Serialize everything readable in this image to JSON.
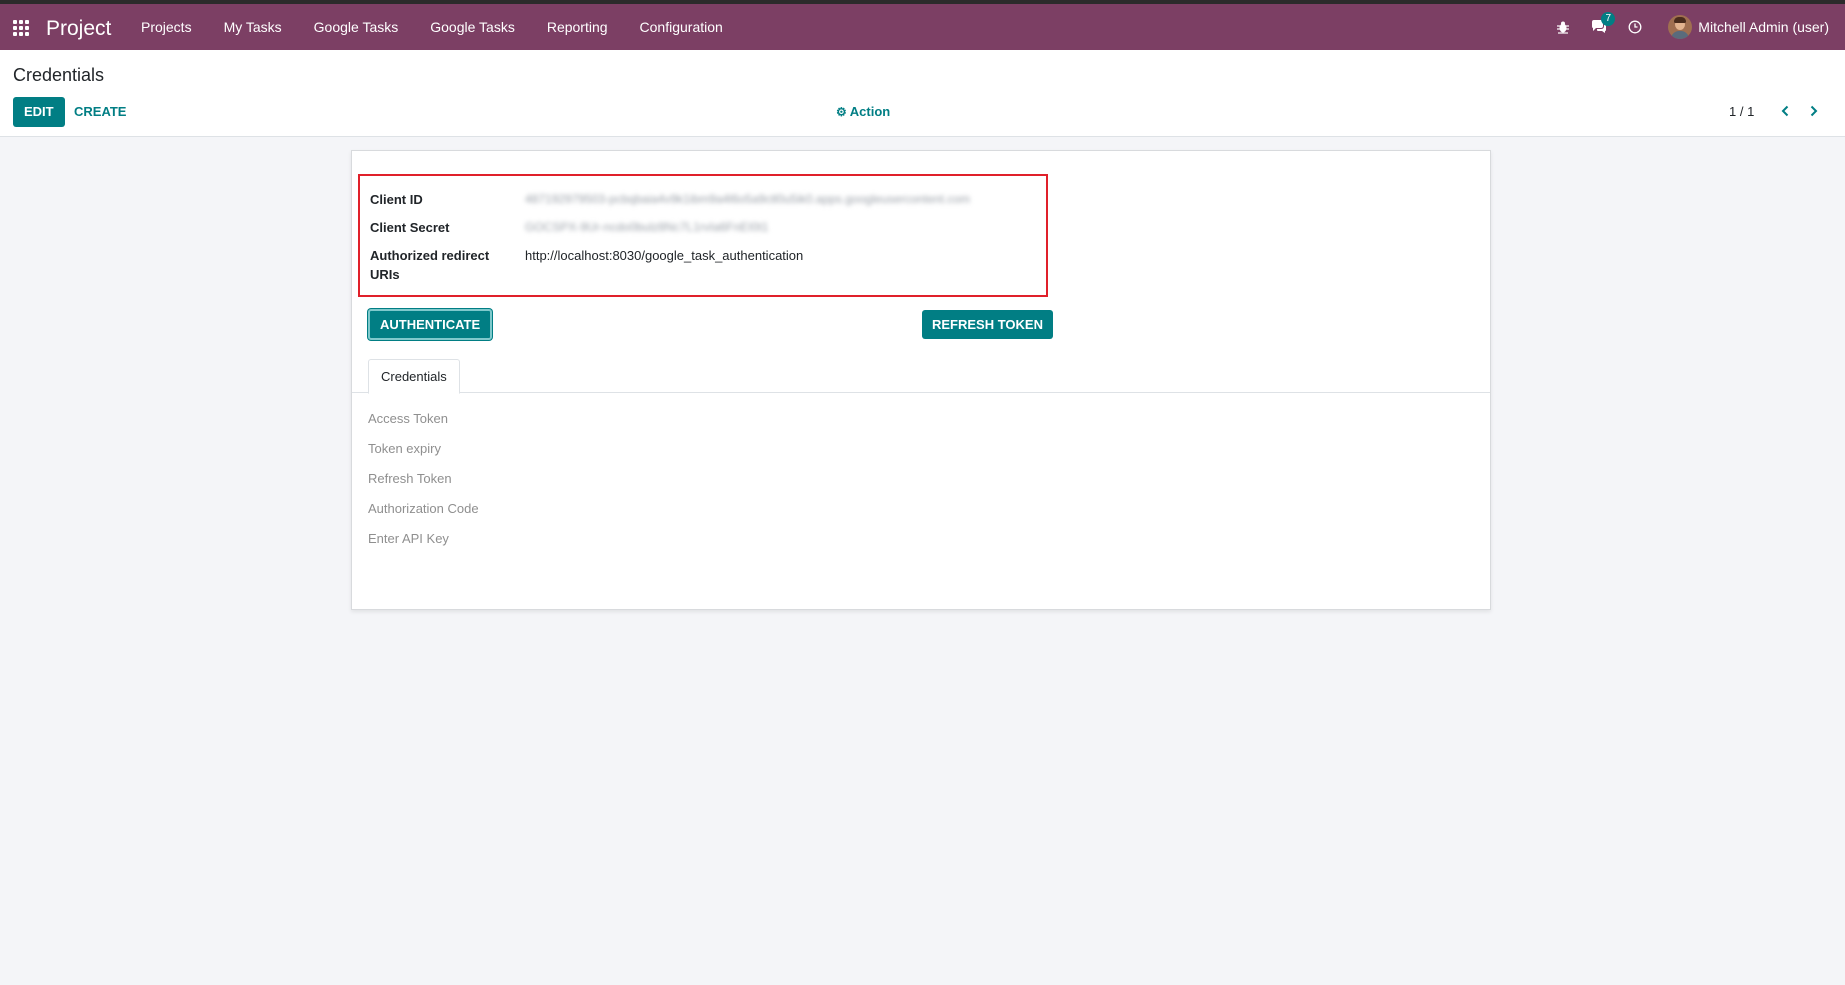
{
  "navbar": {
    "app_name": "Project",
    "menu": [
      "Projects",
      "My Tasks",
      "Google Tasks",
      "Google Tasks",
      "Reporting",
      "Configuration"
    ],
    "messages_count": "7",
    "user_name": "Mitchell Admin (user)"
  },
  "control_panel": {
    "breadcrumb": "Credentials",
    "edit_label": "EDIT",
    "create_label": "CREATE",
    "action_label": "Action",
    "pager": "1 / 1"
  },
  "form": {
    "client_id_label": "Client ID",
    "client_id_value": "487192979503-pcbqbaia4v9k1ibm9a4l6o5a9ctl0u5ik0.apps.googleusercontent.com",
    "client_secret_label": "Client Secret",
    "client_secret_value": "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0t1",
    "redirect_label_line1": "Authorized redirect",
    "redirect_label_line2": "URIs",
    "redirect_value": "http://localhost:8030/google_task_authentication",
    "authenticate_label": "AUTHENTICATE",
    "refresh_token_label": "REFRESH TOKEN",
    "tab_label": "Credentials",
    "tab_fields": [
      "Access Token",
      "Token expiry",
      "Refresh Token",
      "Authorization Code",
      "Enter API Key"
    ]
  },
  "colors": {
    "navbar": "#7c3f64",
    "primary": "#017e84",
    "highlight_border": "#e0202a",
    "background": "#f4f5f8"
  }
}
